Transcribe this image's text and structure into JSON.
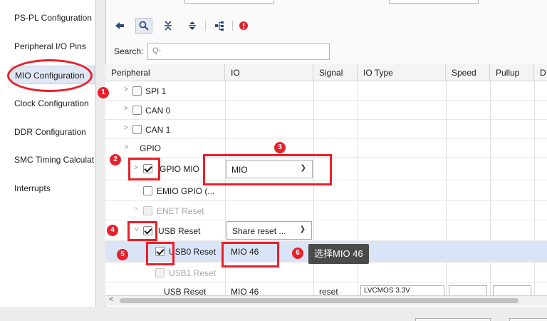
{
  "nav": {
    "items": [
      {
        "label": "PS-PL Configuration"
      },
      {
        "label": "Peripheral I/O Pins"
      },
      {
        "label": "MIO Configuration",
        "active": true
      },
      {
        "label": "Clock Configuration"
      },
      {
        "label": "DDR Configuration"
      },
      {
        "label": "SMC Timing Calculat"
      },
      {
        "label": "Interrupts"
      }
    ]
  },
  "toolbar": {
    "icons": [
      "back-arrow-icon",
      "search-icon",
      "collapse-all-icon",
      "expand-all-icon",
      "hierarchy-icon",
      "error-icon"
    ]
  },
  "search": {
    "label": "Search:",
    "placeholder": "Q-"
  },
  "table": {
    "columns": [
      "Peripheral",
      "IO",
      "Signal",
      "IO Type",
      "Speed",
      "Pullup",
      "D"
    ],
    "rows": [
      {
        "label": "SPI 1",
        "checked": false
      },
      {
        "label": "CAN 0",
        "checked": false
      },
      {
        "label": "CAN 1",
        "checked": false
      },
      {
        "label": "GPIO"
      },
      {
        "label": "GPIO MIO",
        "checked": true,
        "io": "MIO"
      },
      {
        "label": "EMIO GPIO (...",
        "checked": false
      },
      {
        "label": "ENET Reset",
        "checked": false,
        "disabled": true
      },
      {
        "label": "USB Reset",
        "checked": true,
        "io": "Share reset ..."
      },
      {
        "label": "USB0 Reset",
        "checked": true,
        "io": "MIO 46"
      },
      {
        "label": "USB1 Reset",
        "checked": false,
        "disabled": true
      },
      {
        "label": "USB Reset",
        "io": "MIO 46",
        "signal": "reset",
        "io_type": "LVCMOS 3.3V"
      }
    ]
  },
  "annotations": {
    "badges": [
      "1",
      "2",
      "3",
      "4",
      "5",
      "6"
    ],
    "tooltip": "选择MIO 46"
  },
  "colors": {
    "annotation_red": "#e8202a",
    "selected_row": "#d9e4f7",
    "tooltip_bg": "#4a4a4a"
  }
}
